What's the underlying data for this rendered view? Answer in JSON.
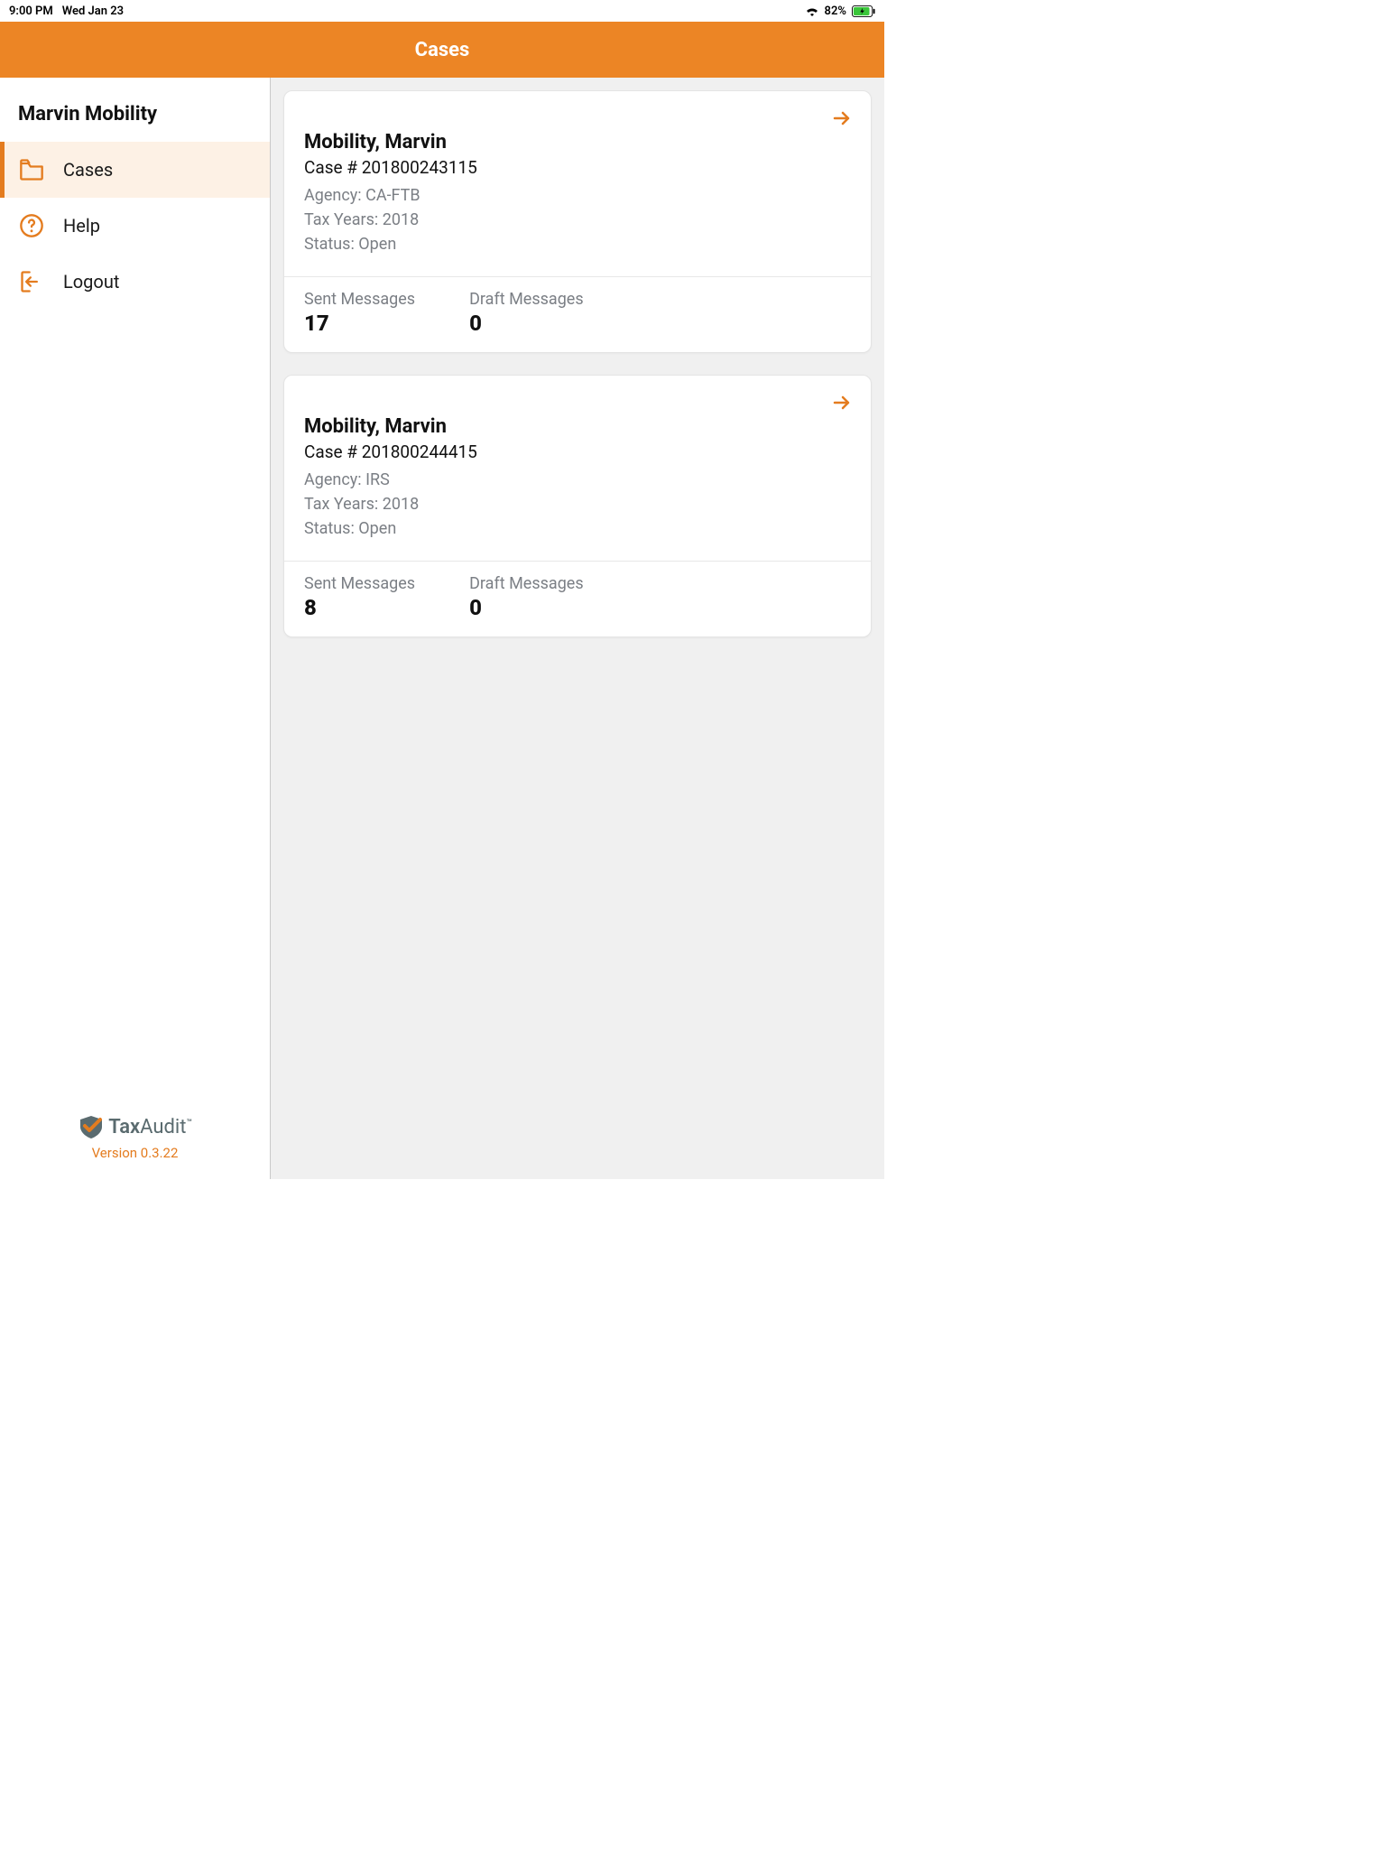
{
  "status": {
    "time": "9:00 PM",
    "date": "Wed Jan 23",
    "battery_pct": "82%"
  },
  "header": {
    "title": "Cases"
  },
  "sidebar": {
    "username": "Marvin Mobility",
    "items": [
      {
        "label": "Cases",
        "icon": "folder-icon",
        "active": true
      },
      {
        "label": "Help",
        "icon": "help-icon",
        "active": false
      },
      {
        "label": "Logout",
        "icon": "logout-icon",
        "active": false
      }
    ],
    "logo_text_1": "Tax",
    "logo_text_2": "Audit",
    "version": "Version 0.3.22"
  },
  "labels": {
    "case_prefix": "Case # ",
    "agency_prefix": "Agency: ",
    "taxyears_prefix": "Tax Years: ",
    "status_prefix": "Status: ",
    "sent_messages": "Sent Messages",
    "draft_messages": "Draft Messages"
  },
  "cases": [
    {
      "name": "Mobility, Marvin",
      "number": "201800243115",
      "agency": "CA-FTB",
      "tax_years": "2018",
      "status": "Open",
      "sent": "17",
      "draft": "0"
    },
    {
      "name": "Mobility, Marvin",
      "number": "201800244415",
      "agency": "IRS",
      "tax_years": "2018",
      "status": "Open",
      "sent": "8",
      "draft": "0"
    }
  ]
}
